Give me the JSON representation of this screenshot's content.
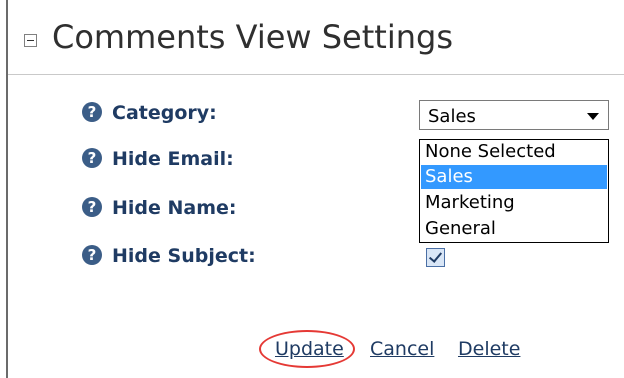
{
  "header": {
    "title": "Comments View Settings",
    "collapse_icon": "collapse-minus-icon"
  },
  "fields": {
    "category_label": "Category:",
    "hide_email_label": "Hide Email:",
    "hide_name_label": "Hide Name:",
    "hide_subject_label": "Hide Subject:",
    "help_icon_glyph": "?"
  },
  "category_select": {
    "value": "Sales",
    "options": [
      "None Selected",
      "Sales",
      "Marketing",
      "General"
    ],
    "highlighted_option": "Sales",
    "expanded": true
  },
  "hide_subject_checkbox": {
    "checked": true
  },
  "actions": {
    "update_label": "Update",
    "cancel_label": "Cancel",
    "delete_label": "Delete",
    "highlight_color": "#e53935"
  },
  "colors": {
    "label_color": "#1f3b63",
    "link_color": "#1f3b63",
    "selection_bg": "#3399ff"
  }
}
